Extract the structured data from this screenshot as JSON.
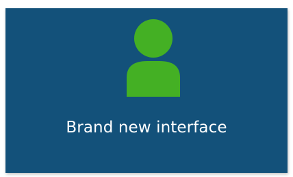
{
  "tile": {
    "label": "Brand new interface",
    "icon": "user-icon",
    "background_color": "#13517a",
    "icon_color": "#44b024",
    "text_color": "#ffffff"
  }
}
